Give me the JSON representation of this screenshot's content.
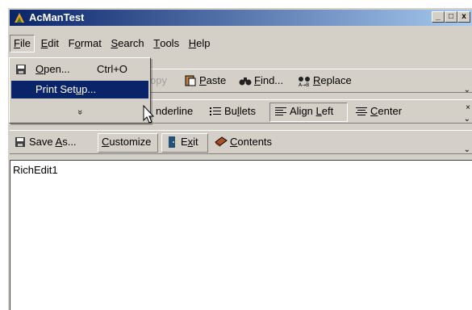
{
  "window": {
    "title": "AcManTest",
    "min": "_",
    "max": "□",
    "close": "x"
  },
  "menubar": {
    "items": [
      {
        "pre": "",
        "u": "F",
        "post": "ile"
      },
      {
        "pre": "",
        "u": "E",
        "post": "dit"
      },
      {
        "pre": "F",
        "u": "o",
        "post": "rmat"
      },
      {
        "pre": "",
        "u": "S",
        "post": "earch"
      },
      {
        "pre": "",
        "u": "T",
        "post": "ools"
      },
      {
        "pre": "",
        "u": "H",
        "post": "elp"
      }
    ]
  },
  "file_menu": {
    "open": {
      "pre": "",
      "u": "O",
      "post": "pen...",
      "shortcut": "Ctrl+O"
    },
    "print_setup": {
      "pre": "Print Set",
      "u": "u",
      "post": "p..."
    },
    "more": "»"
  },
  "toolbar1": {
    "copy_fragment": "opy",
    "paste": {
      "pre": "",
      "u": "P",
      "post": "aste"
    },
    "find": {
      "pre": "",
      "u": "F",
      "post": "ind..."
    },
    "replace": {
      "pre": "",
      "u": "R",
      "post": "eplace"
    }
  },
  "toolbar2": {
    "underline_fragment": "nderline",
    "bullets": {
      "pre": "Bu",
      "u": "l",
      "post": "lets"
    },
    "align_left": {
      "pre": "Align ",
      "u": "L",
      "post": "eft"
    },
    "center": {
      "pre": "",
      "u": "C",
      "post": "enter"
    }
  },
  "toolbar3": {
    "save_as": {
      "pre": "Save ",
      "u": "A",
      "post": "s..."
    },
    "customize": {
      "pre": "",
      "u": "C",
      "post": "ustomize"
    },
    "exit": {
      "pre": "E",
      "u": "x",
      "post": "it"
    },
    "contents": {
      "pre": "",
      "u": "C",
      "post": "ontents"
    }
  },
  "editor": {
    "text": "RichEdit1"
  },
  "colors": {
    "title_start": "#0a246a",
    "title_end": "#a6caf0",
    "face": "#d4d0c8",
    "highlight": "#0a246a"
  }
}
